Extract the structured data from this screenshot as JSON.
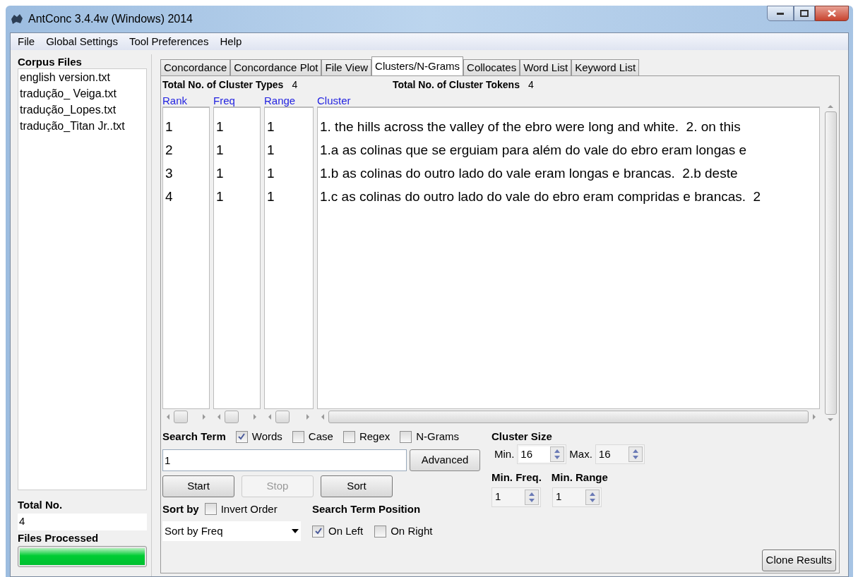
{
  "window": {
    "title": "AntConc 3.4.4w (Windows) 2014"
  },
  "menu": [
    "File",
    "Global Settings",
    "Tool Preferences",
    "Help"
  ],
  "corpus_files": {
    "heading": "Corpus Files",
    "files": [
      "english version.txt",
      "tradução_ Veiga.txt",
      "tradução_Lopes.txt",
      "tradução_Titan Jr..txt"
    ]
  },
  "total": {
    "label": "Total No.",
    "value": "4"
  },
  "files_processed": {
    "label": "Files Processed",
    "level": 1
  },
  "tabs": [
    {
      "label": "Concordance",
      "selected": false
    },
    {
      "label": "Concordance Plot",
      "selected": false
    },
    {
      "label": "File View",
      "selected": false
    },
    {
      "label": "Clusters/N-Grams",
      "selected": true
    },
    {
      "label": "Collocates",
      "selected": false
    },
    {
      "label": "Word List",
      "selected": false
    },
    {
      "label": "Keyword List",
      "selected": false
    }
  ],
  "summary": [
    {
      "label": "Total No. of Cluster Types",
      "value": "4"
    },
    {
      "label": "Total No. of Cluster Tokens",
      "value": "4"
    }
  ],
  "table": {
    "columns": [
      "Rank",
      "Freq",
      "Range",
      "Cluster"
    ],
    "rows": [
      [
        "1",
        "1",
        "1",
        "1. the hills across the valley of the ebro were long and white.  2. on this"
      ],
      [
        "2",
        "1",
        "1",
        "1.a as colinas que se erguiam para além do vale do ebro eram longas e"
      ],
      [
        "3",
        "1",
        "1",
        "1.b as colinas do outro lado do vale eram longas e brancas.  2.b deste"
      ],
      [
        "4",
        "1",
        "1",
        "1.c as colinas do outro lado do vale do ebro eram compridas e brancas.  2"
      ]
    ]
  },
  "search": {
    "label": "Search Term",
    "options": [
      {
        "label": "Words",
        "checked": true
      },
      {
        "label": "Case",
        "checked": false
      },
      {
        "label": "Regex",
        "checked": false
      },
      {
        "label": "N-Grams",
        "checked": false
      }
    ],
    "value": "1",
    "advanced": "Advanced"
  },
  "buttons": [
    {
      "label": "Start",
      "disabled": false
    },
    {
      "label": "Stop",
      "disabled": true
    },
    {
      "label": "Sort",
      "disabled": false
    }
  ],
  "sort": {
    "label": "Sort by",
    "invert": {
      "label": "Invert Order",
      "checked": false
    },
    "value": "Sort by Freq"
  },
  "position": {
    "label": "Search Term Position",
    "options": [
      {
        "label": "On Left",
        "checked": true
      },
      {
        "label": "On Right",
        "checked": false
      }
    ]
  },
  "cluster_size": {
    "label": "Cluster Size",
    "min_label": "Min.",
    "min": "16",
    "max_label": "Max.",
    "max": "16"
  },
  "min_freq": {
    "label": "Min. Freq.",
    "value": "1"
  },
  "min_range": {
    "label": "Min. Range",
    "value": "1"
  },
  "clone": "Clone Results"
}
